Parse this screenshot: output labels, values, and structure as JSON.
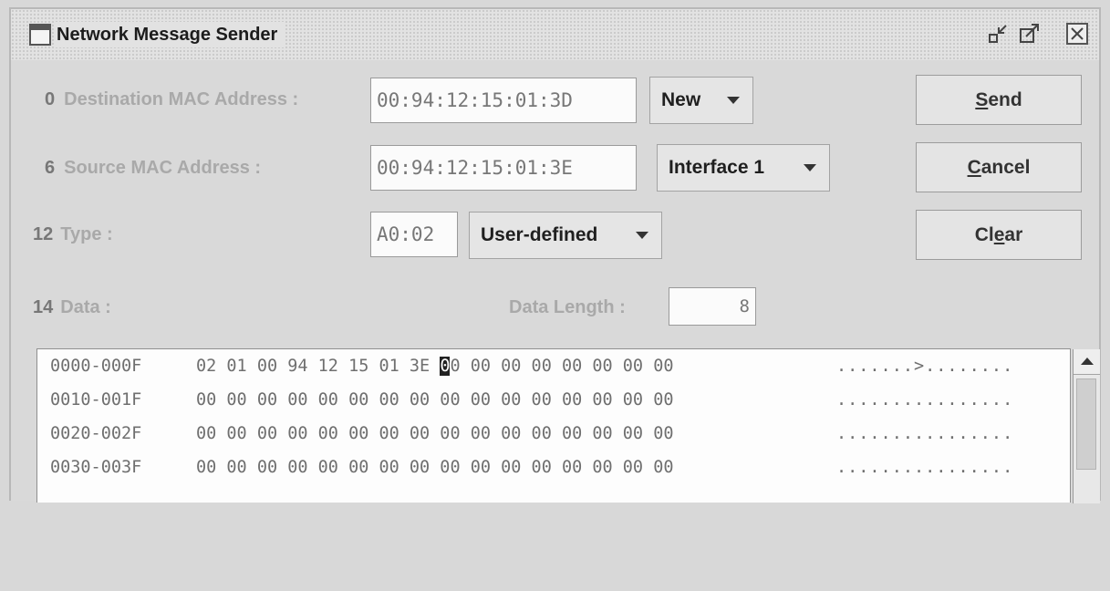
{
  "window": {
    "title": "Network Message Sender"
  },
  "fields": {
    "dest": {
      "offset": "0",
      "label": "Destination MAC Address :",
      "value": "00:94:12:15:01:3D",
      "combo": "New"
    },
    "src": {
      "offset": "6",
      "label": "Source MAC Address :",
      "value": "00:94:12:15:01:3E",
      "combo": "Interface 1"
    },
    "type": {
      "offset": "12",
      "label": "Type :",
      "value": "A0:02",
      "combo": "User-defined"
    },
    "data": {
      "offset": "14",
      "label": "Data :"
    },
    "data_length": {
      "label": "Data Length :",
      "value": "8"
    }
  },
  "buttons": {
    "send": {
      "pre": "",
      "u": "S",
      "post": "end"
    },
    "cancel": {
      "pre": "",
      "u": "C",
      "post": "ancel"
    },
    "clear": {
      "pre": "Cl",
      "u": "e",
      "post": "ar"
    }
  },
  "hex": {
    "rows": [
      {
        "addr": "0000-000F",
        "bytes_before": "02 01 00 94 12 15 01 3E ",
        "cursor_char": "0",
        "bytes_after": "0 00 00 00 00 00 00 00",
        "ascii": ".......>........"
      },
      {
        "addr": "0010-001F",
        "bytes": "00 00 00 00 00 00 00 00 00 00 00 00 00 00 00 00",
        "ascii": "................"
      },
      {
        "addr": "0020-002F",
        "bytes": "00 00 00 00 00 00 00 00 00 00 00 00 00 00 00 00",
        "ascii": "................"
      },
      {
        "addr": "0030-003F",
        "bytes": "00 00 00 00 00 00 00 00 00 00 00 00 00 00 00 00",
        "ascii": "................"
      }
    ]
  },
  "icons": {
    "window": "window-icon",
    "minimize": "minimize-icon",
    "maximize": "maximize-icon",
    "close": "close-icon"
  }
}
